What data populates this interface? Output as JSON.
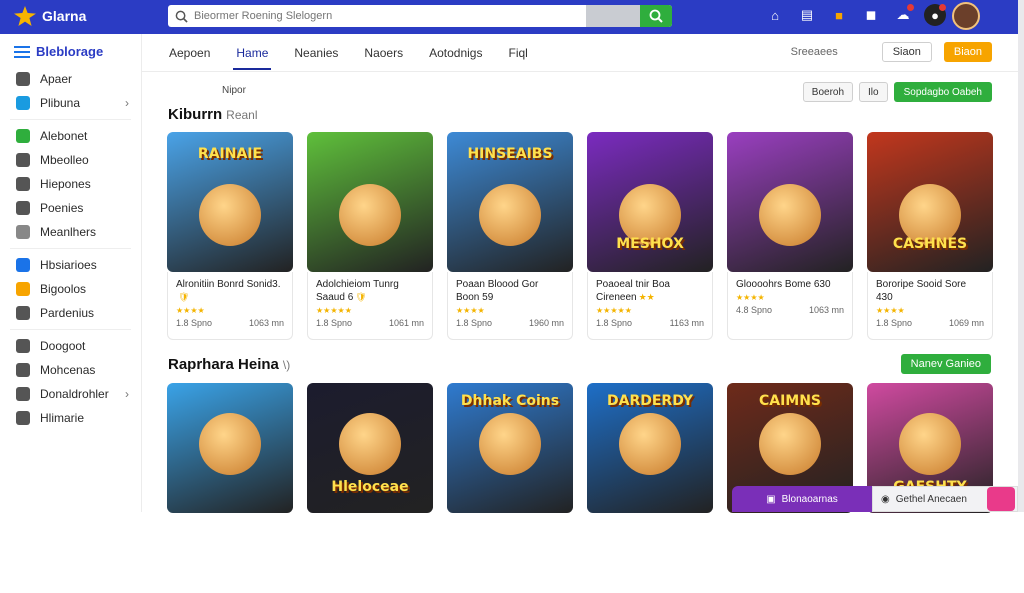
{
  "topbar": {
    "brand": "Glarna",
    "search_placeholder": "Bieormer Roening Slelogern",
    "icons": [
      "home-icon",
      "news-icon",
      "gift-icon",
      "chat-icon",
      "cloud-icon",
      "bell-icon"
    ],
    "accent": "#2b3cc4"
  },
  "sidebar": {
    "title": "Bleblorage",
    "items": [
      {
        "label": "Apaer",
        "icon": "search-icon",
        "color": "#555555"
      },
      {
        "label": "Plibuna",
        "icon": "tag-icon",
        "color": "#1a9be0",
        "chevron": true
      },
      {
        "label": "Alebonet",
        "icon": "controller-icon",
        "color": "#2fae3d"
      },
      {
        "label": "Mbeolleo",
        "icon": "list-icon",
        "color": "#555555"
      },
      {
        "label": "Hiepones",
        "icon": "list-icon",
        "color": "#555555"
      },
      {
        "label": "Poenies",
        "icon": "grid-icon",
        "color": "#555555"
      },
      {
        "label": "Meanlhers",
        "icon": "grid-icon",
        "color": "#888888"
      },
      {
        "label": "Hbsiarioes",
        "icon": "globe-icon",
        "color": "#1a73e8"
      },
      {
        "label": "Bigoolos",
        "icon": "coin-icon",
        "color": "#f7a400"
      },
      {
        "label": "Pardenius",
        "icon": "doc-icon",
        "color": "#555555"
      },
      {
        "label": "Doogoot",
        "icon": "play-icon",
        "color": "#555555"
      },
      {
        "label": "Mohcenas",
        "icon": "list-icon",
        "color": "#555555"
      },
      {
        "label": "Donaldrohler",
        "icon": "disc-icon",
        "color": "#555555",
        "chevron": true
      },
      {
        "label": "Hlimarie",
        "icon": "disc-icon",
        "color": "#555555"
      }
    ]
  },
  "nav": {
    "tabs": [
      "Aepoen",
      "Hame",
      "Neanies",
      "Naoers",
      "Aotodnigs",
      "Fiql"
    ],
    "active_index": 1,
    "right_link": "Sreeaees",
    "signin": "Siaon",
    "signup": "Biaon"
  },
  "subheader": {
    "label": "Nipor",
    "tools": [
      "Boeroh",
      "Ilo"
    ],
    "green_button": "Sopdagbo Oabeh"
  },
  "section1": {
    "title": "Kiburrn",
    "subtitle": "Reanl",
    "cards": [
      {
        "art": "RAINAIE",
        "title": "Alronitiin Bonrd Sonid3.",
        "badge": "🛡",
        "stars": "★★★★",
        "left": "1.8 Spno",
        "right": "1063 mn",
        "bg": "#4aa3e8"
      },
      {
        "art": "",
        "title": "Adolchieiom Tunrg Saaud 6",
        "badge": "🛡",
        "stars": "★★★★★",
        "left": "1.8 Spno",
        "right": "1061 mn",
        "bg": "#5fc03b"
      },
      {
        "art": "HINSEAIBS",
        "title": "Poaan Bloood Gor Boon 59",
        "badge": "",
        "stars": "★★★★",
        "left": "1.8 Spno",
        "right": "1960 mn",
        "bg": "#3d8ad6"
      },
      {
        "art": "MESHOX",
        "title": "Poaoeal tnir Boa Cireneen",
        "badge": "★★",
        "stars": "★★★★★",
        "left": "1.8 Spno",
        "right": "1163 mn",
        "bg": "#7b2bc0"
      },
      {
        "art": "",
        "title": "Gloooohrs Bome 630",
        "badge": "",
        "stars": "★★★★",
        "left": "4.8 Spno",
        "right": "1063 mn",
        "bg": "#9a3fc0"
      },
      {
        "art": "CASHNES",
        "title": "Bororipe Sooid Sore 430",
        "badge": "",
        "stars": "★★★★",
        "left": "1.8 Spno",
        "right": "1069 mn",
        "bg": "#c2371d"
      }
    ]
  },
  "section2": {
    "title": "Raprhara Heina",
    "subtitle": "\\)",
    "button": "Nanev Ganieo",
    "cards": [
      {
        "art": "",
        "bg": "#3aa3e8"
      },
      {
        "art": "Hleloceae",
        "bg": "#1c1c2e"
      },
      {
        "art": "Dhhak Coins",
        "bg": "#2f7bd0"
      },
      {
        "art": "DARDERDY",
        "bg": "#1e6fc8"
      },
      {
        "art": "CAIMNS",
        "bg": "#6e2a1a"
      },
      {
        "art": "GAESHTY",
        "bg": "#d04aa0"
      }
    ]
  },
  "bottom": {
    "left_text": "Blonaoarnas",
    "right_text": "Gethel Anecaen"
  }
}
